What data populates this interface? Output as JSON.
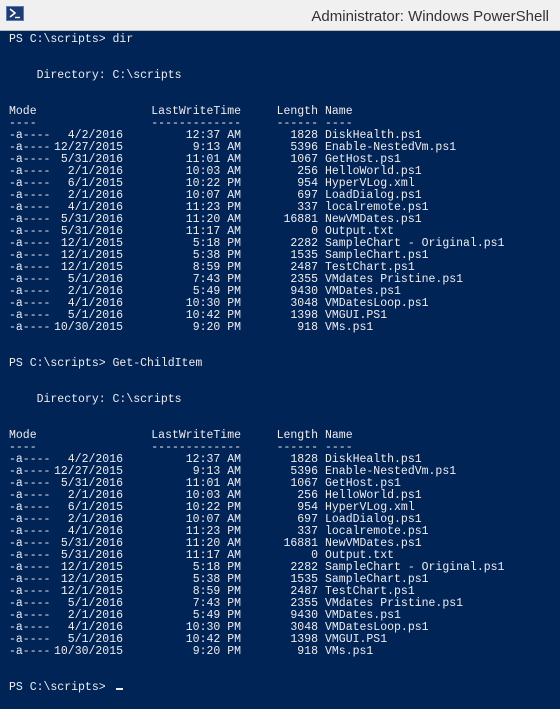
{
  "window": {
    "title": "Administrator: Windows PowerShell",
    "icon": "powershell-icon"
  },
  "colors": {
    "console_background": "#012456",
    "console_text": "#eeedf0",
    "titlebar_background": "#f0f0f0"
  },
  "console": {
    "blocks": [
      {
        "prompt": "PS C:\\scripts> ",
        "command": "dir",
        "directory_line": "    Directory: C:\\scripts",
        "headers": [
          "Mode",
          "LastWriteTime",
          "Length",
          "Name"
        ],
        "underlines": [
          "----",
          "-------------",
          "------",
          "----"
        ],
        "rows": [
          {
            "mode": "-a----",
            "date": "4/2/2016",
            "time": "12:37 AM",
            "length": "1828",
            "name": "DiskHealth.ps1"
          },
          {
            "mode": "-a----",
            "date": "12/27/2015",
            "time": "9:13 AM",
            "length": "5396",
            "name": "Enable-NestedVm.ps1"
          },
          {
            "mode": "-a----",
            "date": "5/31/2016",
            "time": "11:01 AM",
            "length": "1067",
            "name": "GetHost.ps1"
          },
          {
            "mode": "-a----",
            "date": "2/1/2016",
            "time": "10:03 AM",
            "length": "256",
            "name": "HelloWorld.ps1"
          },
          {
            "mode": "-a----",
            "date": "6/1/2015",
            "time": "10:22 PM",
            "length": "954",
            "name": "HyperVLog.xml"
          },
          {
            "mode": "-a----",
            "date": "2/1/2016",
            "time": "10:07 AM",
            "length": "697",
            "name": "LoadDialog.ps1"
          },
          {
            "mode": "-a----",
            "date": "4/1/2016",
            "time": "11:23 PM",
            "length": "337",
            "name": "localremote.ps1"
          },
          {
            "mode": "-a----",
            "date": "5/31/2016",
            "time": "11:20 AM",
            "length": "16881",
            "name": "NewVMDates.ps1"
          },
          {
            "mode": "-a----",
            "date": "5/31/2016",
            "time": "11:17 AM",
            "length": "0",
            "name": "Output.txt"
          },
          {
            "mode": "-a----",
            "date": "12/1/2015",
            "time": "5:18 PM",
            "length": "2282",
            "name": "SampleChart - Original.ps1"
          },
          {
            "mode": "-a----",
            "date": "12/1/2015",
            "time": "5:38 PM",
            "length": "1535",
            "name": "SampleChart.ps1"
          },
          {
            "mode": "-a----",
            "date": "12/1/2015",
            "time": "8:59 PM",
            "length": "2487",
            "name": "TestChart.ps1"
          },
          {
            "mode": "-a----",
            "date": "5/1/2016",
            "time": "7:43 PM",
            "length": "2355",
            "name": "VMdates Pristine.ps1"
          },
          {
            "mode": "-a----",
            "date": "2/1/2016",
            "time": "5:49 PM",
            "length": "9430",
            "name": "VMDates.ps1"
          },
          {
            "mode": "-a----",
            "date": "4/1/2016",
            "time": "10:30 PM",
            "length": "3048",
            "name": "VMDatesLoop.ps1"
          },
          {
            "mode": "-a----",
            "date": "5/1/2016",
            "time": "10:42 PM",
            "length": "1398",
            "name": "VMGUI.PS1"
          },
          {
            "mode": "-a----",
            "date": "10/30/2015",
            "time": "9:20 PM",
            "length": "918",
            "name": "VMs.ps1"
          }
        ]
      },
      {
        "prompt": "PS C:\\scripts> ",
        "command": "Get-ChildItem",
        "directory_line": "    Directory: C:\\scripts",
        "headers": [
          "Mode",
          "LastWriteTime",
          "Length",
          "Name"
        ],
        "underlines": [
          "----",
          "-------------",
          "------",
          "----"
        ],
        "rows": [
          {
            "mode": "-a----",
            "date": "4/2/2016",
            "time": "12:37 AM",
            "length": "1828",
            "name": "DiskHealth.ps1"
          },
          {
            "mode": "-a----",
            "date": "12/27/2015",
            "time": "9:13 AM",
            "length": "5396",
            "name": "Enable-NestedVm.ps1"
          },
          {
            "mode": "-a----",
            "date": "5/31/2016",
            "time": "11:01 AM",
            "length": "1067",
            "name": "GetHost.ps1"
          },
          {
            "mode": "-a----",
            "date": "2/1/2016",
            "time": "10:03 AM",
            "length": "256",
            "name": "HelloWorld.ps1"
          },
          {
            "mode": "-a----",
            "date": "6/1/2015",
            "time": "10:22 PM",
            "length": "954",
            "name": "HyperVLog.xml"
          },
          {
            "mode": "-a----",
            "date": "2/1/2016",
            "time": "10:07 AM",
            "length": "697",
            "name": "LoadDialog.ps1"
          },
          {
            "mode": "-a----",
            "date": "4/1/2016",
            "time": "11:23 PM",
            "length": "337",
            "name": "localremote.ps1"
          },
          {
            "mode": "-a----",
            "date": "5/31/2016",
            "time": "11:20 AM",
            "length": "16881",
            "name": "NewVMDates.ps1"
          },
          {
            "mode": "-a----",
            "date": "5/31/2016",
            "time": "11:17 AM",
            "length": "0",
            "name": "Output.txt"
          },
          {
            "mode": "-a----",
            "date": "12/1/2015",
            "time": "5:18 PM",
            "length": "2282",
            "name": "SampleChart - Original.ps1"
          },
          {
            "mode": "-a----",
            "date": "12/1/2015",
            "time": "5:38 PM",
            "length": "1535",
            "name": "SampleChart.ps1"
          },
          {
            "mode": "-a----",
            "date": "12/1/2015",
            "time": "8:59 PM",
            "length": "2487",
            "name": "TestChart.ps1"
          },
          {
            "mode": "-a----",
            "date": "5/1/2016",
            "time": "7:43 PM",
            "length": "2355",
            "name": "VMdates Pristine.ps1"
          },
          {
            "mode": "-a----",
            "date": "2/1/2016",
            "time": "5:49 PM",
            "length": "9430",
            "name": "VMDates.ps1"
          },
          {
            "mode": "-a----",
            "date": "4/1/2016",
            "time": "10:30 PM",
            "length": "3048",
            "name": "VMDatesLoop.ps1"
          },
          {
            "mode": "-a----",
            "date": "5/1/2016",
            "time": "10:42 PM",
            "length": "1398",
            "name": "VMGUI.PS1"
          },
          {
            "mode": "-a----",
            "date": "10/30/2015",
            "time": "9:20 PM",
            "length": "918",
            "name": "VMs.ps1"
          }
        ]
      }
    ],
    "final_prompt": "PS C:\\scripts> "
  }
}
